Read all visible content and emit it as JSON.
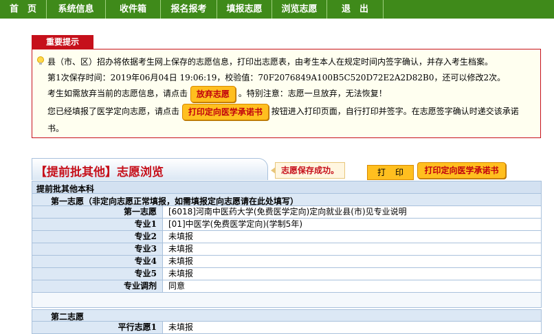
{
  "nav": {
    "items": [
      "首　页",
      "系统信息",
      "收件箱",
      "报名报考",
      "填报志愿",
      "浏览志愿",
      "退　出"
    ]
  },
  "notice": {
    "tab_label": "重要提示",
    "line1": "县（市、区）招办将依据考生网上保存的志愿信息，打印出志愿表，由考生本人在规定时间内签字确认，并存入考生档案。",
    "line2": "第1次保存时间：2019年06月04日 19:06:19，校验值：70F2076849A100B5C520D72E2A2D82B0，还可以修改2次。",
    "line3_pre": "考生如需放弃当前的志愿信息，请点击",
    "abandon_button": "放弃志愿",
    "line3_post": "。特别注意：志愿一旦放弃，无法恢复！",
    "line4_pre": "您已经填报了医学定向志愿，请点击",
    "pledge_button": "打印定向医学承诺书",
    "line4_post": "按钮进入打印页面，自行打印并签字。在志愿签字确认时递交该承诺",
    "line5": "书。"
  },
  "section": {
    "title": "【提前批其他】志愿浏览",
    "save_message": "志愿保存成功。",
    "print_button": "打印",
    "print_pledge_button": "打印定向医学承诺书"
  },
  "table": {
    "group_header": "提前批其他本科",
    "first_choice_header": "第一志愿（非定向志愿正常填报，如需填报定向志愿请在此处填写）",
    "first_rows": [
      {
        "label": "第一志愿",
        "value": "[6018]河南中医药大学(免费医学定向)定向就业县(市)见专业说明"
      },
      {
        "label": "专业1",
        "value": "[01]中医学(免费医学定向)(学制5年)"
      },
      {
        "label": "专业2",
        "value": "未填报"
      },
      {
        "label": "专业3",
        "value": "未填报"
      },
      {
        "label": "专业4",
        "value": "未填报"
      },
      {
        "label": "专业5",
        "value": "未填报"
      },
      {
        "label": "专业调剂",
        "value": "同意"
      }
    ],
    "second_choice_header": "第二志愿",
    "second_rows": [
      {
        "label": "平行志愿1",
        "value": "未填报"
      }
    ]
  },
  "colors": {
    "nav_green": "#3f8a1a",
    "accent_red": "#c6101b",
    "button_orange": "#ffbf1f",
    "table_blue": "#dce8f5"
  }
}
